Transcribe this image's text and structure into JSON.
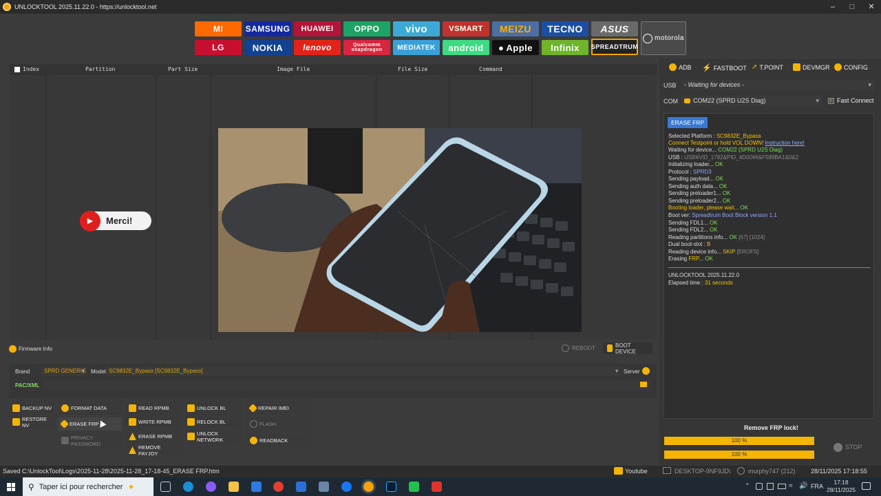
{
  "window": {
    "title": "UNLOCKTOOL 2025.11.22.0 - https://unlocktool.net"
  },
  "brands": {
    "row1": [
      "MI",
      "SAMSUNG",
      "HUAWEI",
      "OPPO",
      "vivo",
      "VSMART",
      "MEIZU",
      "TECNO",
      "ASUS"
    ],
    "row2": [
      "LG",
      "NOKIA",
      "lenovo",
      "Qualcomm snapdragon",
      "MEDIATEK",
      "android",
      "Apple",
      "Infinix",
      "SPREADTRUM"
    ],
    "motorola": "motorola"
  },
  "partition_table": {
    "columns": [
      "Index",
      "Partition",
      "Part Size",
      "Image File",
      "File Size",
      "Command"
    ]
  },
  "merci_label": "Merci!",
  "firmware_info": "Firmware Info",
  "reboot": "REBOOT",
  "boot_device": "BOOT DEVICE",
  "brand_label": "Brand",
  "brand_value": "SPRD GENERIC",
  "model_label": "Model",
  "model_value": "SC9832E_Bypass [SC9832E_Bypass]",
  "server_label": "Server",
  "pac_label": "PAC/XML",
  "buttons": {
    "backup_nv": "BACKUP NV",
    "restore_nv": "RESTORE NV",
    "format_data": "FORMAT DATA",
    "erase_frp": "ERASE FRP",
    "privacy_password": "PRIVACY PASSWORD",
    "read_rpmb": "READ RPMB",
    "write_rpmb": "WRITE RPMB",
    "erase_rpmb": "ERASE RPMB",
    "remove_payjoy": "REMOVE PAYJOY",
    "unlock_bl": "UNLOCK BL",
    "relock_bl": "RELOCK BL",
    "unlock_network": "UNLOCK NETWORK",
    "repair_imei": "REPAIR IMEI",
    "flash": "FLASH",
    "readback": "READBACK"
  },
  "tools": [
    "ADB",
    "FASTBOOT",
    "T.POINT",
    "DEVMGR",
    "CONFIG"
  ],
  "usb_label": "USB",
  "usb_value": "- Waiting for devices -",
  "com_label": "COM",
  "com_value": "COM22 (SPRD U2S Diag)",
  "fast_connect": "Fast Connect",
  "erase_frp_tag": "ERASE FRP",
  "log": {
    "l1a": "Selected Platform : ",
    "l1b": "SC9832E_Bypass",
    "l2a": "Connect Testpoint or hold VOL DOWN! ",
    "l2b": "Instruction here!",
    "l3a": "Waiting for device... ",
    "l3b": "COM22 (SPRD U2S Diag)",
    "l4a": "USB : ",
    "l4b": "USB¥VID_1782&PID_4D00¥6&F589BA1&0&2",
    "l5a": "Initializing loader... ",
    "l5b": "OK",
    "l6a": "Protocol : ",
    "l6b": "SPRD3",
    "l7a": "Sending payload... ",
    "l7b": "OK",
    "l8a": "Sending auth data... ",
    "l8b": "OK",
    "l9a": "Sending preloader1... ",
    "l9b": "OK",
    "l10a": "Sending preloader2... ",
    "l10b": "OK",
    "l11a": "Booting loader, please wait... ",
    "l11b": "OK",
    "l12a": "Boot ver: ",
    "l12b": "Spreadtrum Boot Block version 1.1",
    "l13a": "Sending FDL1... ",
    "l13b": "OK",
    "l14a": "Sending FDL2... ",
    "l14b": "OK",
    "l15a": "Reading partitions info... ",
    "l15b": "OK",
    "l15c": " [67] [1024]",
    "l16a": "Dual boot-slot : ",
    "l16b": "B",
    "l17a": "Reading device info... ",
    "l17b": "SKIP",
    "l17c": " [EROFS]",
    "l18a": "Erasing ",
    "l18b": "FRP",
    "l18c": "... ",
    "l18d": "OK",
    "version": "UNLOCKTOOL 2025.11.22.0",
    "elapsed_a": "Elapsed time : ",
    "elapsed_b": "31 seconds"
  },
  "remove_frp": "Remove FRP lock!",
  "progress1": "100 %",
  "progress2": "100 %",
  "progress_value": 1.0,
  "stop": "STOP",
  "statusbar": {
    "saved": "Saved C:\\UnlockTool\\Logs\\2025-11-28\\2025-11-28_17-18-45_ERASE FRP.htm",
    "youtube": "Youtube",
    "desktop": "DESKTOP-9NF9JD\\",
    "user": "murphy747 (212)",
    "datetime": "28/11/2025 17:18:55"
  },
  "taskbar": {
    "search": "Taper ici pour rechercher",
    "lang": "FRA",
    "time": "17:18",
    "date": "28/11/2025"
  }
}
